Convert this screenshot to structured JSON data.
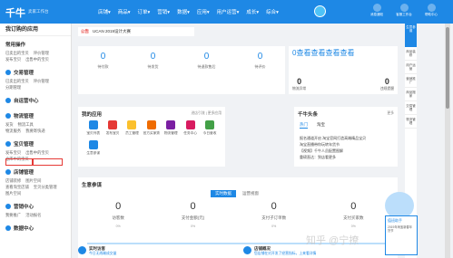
{
  "header": {
    "logo": "千牛",
    "logo_sub": "卖家工作台",
    "nav": [
      "店铺▾",
      "商品▾",
      "订单▾",
      "营销▾",
      "数据▾",
      "应用▾",
      "用户运营▾",
      "成长▾",
      "综合▾"
    ],
    "tools": [
      "消息通知",
      "客服工作台",
      "帮助中心"
    ]
  },
  "sidebar": {
    "header": "我订购的应用",
    "sections": [
      {
        "title": "常用操作",
        "rows": [
          [
            "已卖出的宝贝",
            "评价管理"
          ],
          [
            "发布宝贝",
            "出售中的宝贝"
          ]
        ]
      },
      {
        "title": "交易管理",
        "rows": [
          [
            "已卖出的宝贝",
            "评价管理"
          ],
          [
            "分期管理"
          ]
        ]
      },
      {
        "title": "自运营中心",
        "rows": []
      },
      {
        "title": "物流管理",
        "rows": [
          [
            "发货",
            "物流工具"
          ],
          [
            "物流服务",
            "我要寄快递"
          ]
        ]
      },
      {
        "title": "宝贝管理",
        "rows": [
          [
            "发布宝贝",
            "出售中的宝贝"
          ],
          [
            "仓库中的宝贝"
          ]
        ]
      },
      {
        "title": "店铺管理",
        "rows": [
          [
            "店铺装修",
            "图片空间"
          ],
          [
            "查看淘宝店铺",
            "宝贝分类管理"
          ],
          [
            "图片空间"
          ]
        ]
      },
      {
        "title": "营销中心",
        "rows": [
          [
            "我要推广",
            "活动报名"
          ]
        ]
      },
      {
        "title": "数据中心",
        "rows": []
      }
    ]
  },
  "notice": {
    "tag": "公告",
    "text": "UCAN 2019设计大赛"
  },
  "stats": [
    {
      "value": "0",
      "label": "待付款"
    },
    {
      "value": "0",
      "label": "待发货"
    },
    {
      "value": "0",
      "label": "待退款售后"
    },
    {
      "value": "0",
      "label": "待评价"
    }
  ],
  "promo": {
    "title": "0查看查看查看查看",
    "stats": [
      {
        "value": "0",
        "label": "物流异常"
      },
      {
        "value": "0",
        "label": "违规提醒"
      }
    ]
  },
  "apps": {
    "title": "我的应用",
    "link": "进店引流 | 更多应用",
    "items": [
      {
        "label": "宝贝列表",
        "color": "#1e88e5"
      },
      {
        "label": "发布宝贝",
        "color": "#e53935"
      },
      {
        "label": "员工管理",
        "color": "#fbc02d"
      },
      {
        "label": "官方买家秀",
        "color": "#ef6c00"
      },
      {
        "label": "物流管理",
        "color": "#7b1fa2"
      },
      {
        "label": "任务中心",
        "color": "#d81b60"
      },
      {
        "label": "今日营收",
        "color": "#43a047"
      },
      {
        "label": "生意参谋",
        "color": "#1e88e5"
      }
    ]
  },
  "headlines": {
    "title": "千牛头条",
    "more": "更多",
    "tabs": [
      "热门",
      "淘宝"
    ],
    "items": [
      "报名通道开启 淘宝官网打造高端精品宝贝",
      "淘宝直播带你玩转年货节",
      "【视频】千牛人员配置图解",
      "重磅直达：到店看更多"
    ]
  },
  "business": {
    "title": "生意参谋",
    "tabs": [
      "实时数据",
      "运营视窗"
    ],
    "stats": [
      {
        "value": "0",
        "label": "访客数",
        "pct": "0%"
      },
      {
        "value": "0",
        "label": "支付金额(元)",
        "pct": "0%"
      },
      {
        "value": "0",
        "label": "支付子订单数",
        "pct": "0%"
      },
      {
        "value": "0",
        "label": "支付买家数",
        "pct": "0%"
      }
    ]
  },
  "footer": [
    {
      "title": "实时访客",
      "desc": "今日无线端成交量"
    },
    {
      "title": "店铺概况",
      "desc": "您店铺在对开发了经营指标，上来看详情"
    }
  ],
  "rightbar": {
    "top": "生意参谋",
    "items": [
      "商品装修",
      "用户运营",
      "营销推广",
      "商品搬家",
      "交易管理",
      "物流管理"
    ]
  },
  "mascot": {
    "title": "值班助手",
    "desc": "2019年淘宝新春年货节"
  },
  "watermark": "知乎 @宁撩"
}
